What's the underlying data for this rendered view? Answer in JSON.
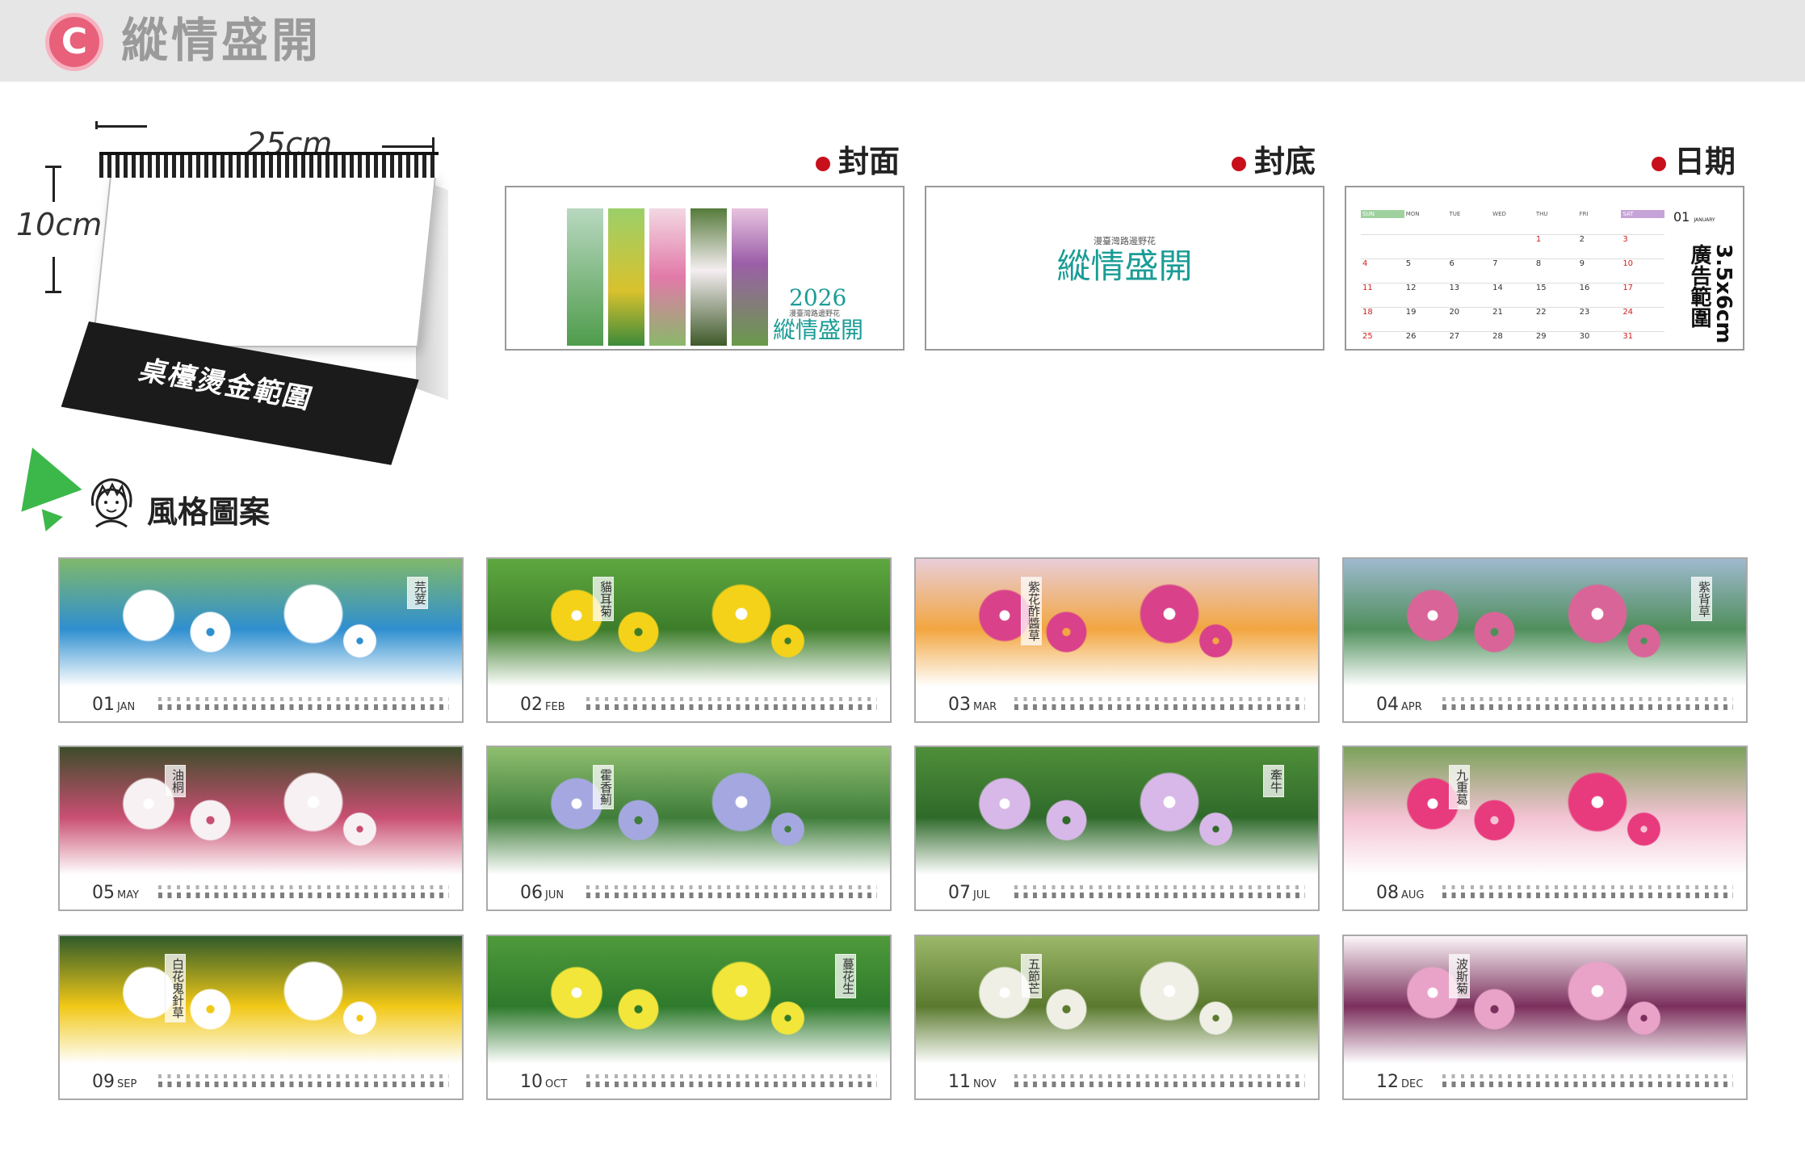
{
  "header": {
    "badge": "C",
    "title": "縱情盛開"
  },
  "product": {
    "width": "25cm",
    "height": "10cm",
    "foil_area": "桌檯燙金範圍"
  },
  "panels": {
    "cover": {
      "heading": "封面",
      "year": "2026",
      "subtitle": "漫臺灣路邊野花",
      "title": "縱情盛開"
    },
    "back": {
      "heading": "封底",
      "subtitle": "漫臺灣路邊野花",
      "title": "縱情盛開"
    },
    "date": {
      "heading": "日期",
      "month": "01",
      "month_name": "JANUARY",
      "ad_area": "3.5x6cm 廣告範圍",
      "weekdays": [
        "SUN",
        "MON",
        "TUE",
        "WED",
        "THU",
        "FRI",
        "SAT"
      ],
      "weeks": [
        [
          "",
          "",
          "",
          "",
          "1",
          "2",
          "3"
        ],
        [
          "4",
          "5",
          "6",
          "7",
          "8",
          "9",
          "10"
        ],
        [
          "11",
          "12",
          "13",
          "14",
          "15",
          "16",
          "17"
        ],
        [
          "18",
          "19",
          "20",
          "21",
          "22",
          "23",
          "24"
        ],
        [
          "25",
          "26",
          "27",
          "28",
          "29",
          "30",
          "31"
        ]
      ]
    }
  },
  "style_section": {
    "title": "風格圖案"
  },
  "months": [
    {
      "num": "01",
      "abbr": "JAN",
      "flower": "芫荽",
      "bg": "#7fb86b",
      "bloom": "#ffffff",
      "accent": "#2f8fd0"
    },
    {
      "num": "02",
      "abbr": "FEB",
      "flower": "貓耳菊",
      "bg": "#5ea83f",
      "bloom": "#f4d21a",
      "accent": "#3d7d2a"
    },
    {
      "num": "03",
      "abbr": "MAR",
      "flower": "紫花酢醬草",
      "bg": "#e9cdd8",
      "bloom": "#d9418a",
      "accent": "#f2a640"
    },
    {
      "num": "04",
      "abbr": "APR",
      "flower": "紫背草",
      "bg": "#9fb9cf",
      "bloom": "#d96598",
      "accent": "#4f8f5c"
    },
    {
      "num": "05",
      "abbr": "MAY",
      "flower": "油桐",
      "bg": "#3d4d2a",
      "bloom": "#f7f1f3",
      "accent": "#c94f72"
    },
    {
      "num": "06",
      "abbr": "JUN",
      "flower": "霍香薊",
      "bg": "#8fbf70",
      "bloom": "#a5a8e0",
      "accent": "#3f7d3a"
    },
    {
      "num": "07",
      "abbr": "JUL",
      "flower": "牽牛",
      "bg": "#4f8f3a",
      "bloom": "#d8b8e8",
      "accent": "#2f6a2a"
    },
    {
      "num": "08",
      "abbr": "AUG",
      "flower": "九重葛",
      "bg": "#7aa25a",
      "bloom": "#e83b7d",
      "accent": "#f3c3d3"
    },
    {
      "num": "09",
      "abbr": "SEP",
      "flower": "白花鬼針草",
      "bg": "#2f5a2a",
      "bloom": "#ffffff",
      "accent": "#f1c817"
    },
    {
      "num": "10",
      "abbr": "OCT",
      "flower": "蔓花生",
      "bg": "#4f9a3a",
      "bloom": "#f2e63a",
      "accent": "#2e7a2c"
    },
    {
      "num": "11",
      "abbr": "NOV",
      "flower": "五節芒",
      "bg": "#9cb86a",
      "bloom": "#efefe6",
      "accent": "#5b7a2e"
    },
    {
      "num": "12",
      "abbr": "DEC",
      "flower": "波斯菊",
      "bg": "#fbf6f8",
      "bloom": "#eaa3c8",
      "accent": "#7b2f5c"
    }
  ]
}
